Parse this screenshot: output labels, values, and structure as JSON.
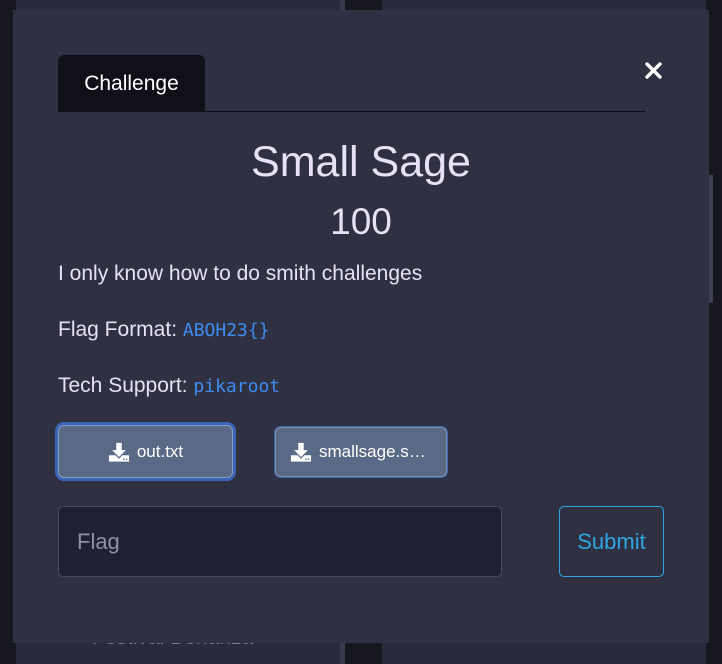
{
  "background": {
    "partial_text": "Festival Bonanza"
  },
  "modal": {
    "tab_label": "Challenge",
    "close_symbol": "×",
    "title": "Small Sage",
    "points": "100",
    "description": "I only know how to do smith challenges",
    "flag_format_label": "Flag Format: ",
    "flag_format_value": "ABOH23{}",
    "tech_support_label": "Tech Support: ",
    "tech_support_value": "pikaroot",
    "files": [
      {
        "label": "out.txt",
        "icon": "download-icon"
      },
      {
        "label": "smallsage.s…",
        "icon": "download-icon"
      }
    ],
    "flag_input": {
      "placeholder": "Flag",
      "value": ""
    },
    "submit_label": "Submit"
  },
  "colors": {
    "modal_bg": "#2f3142",
    "accent_link": "#3d8cf2",
    "submit_accent": "#2ea6e2"
  }
}
